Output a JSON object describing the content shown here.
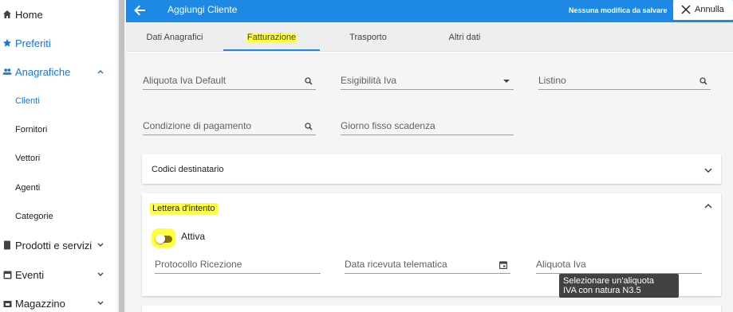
{
  "sidebar": {
    "items": [
      {
        "label": "Home",
        "icon": "home-icon"
      },
      {
        "label": "Preferiti",
        "icon": "star-icon"
      },
      {
        "label": "Anagrafiche",
        "icon": "people-icon",
        "expanded": true
      },
      {
        "label": "Clienti"
      },
      {
        "label": "Fornitori"
      },
      {
        "label": "Vettori"
      },
      {
        "label": "Agenti"
      },
      {
        "label": "Categorie"
      },
      {
        "label": "Prodotti e servizi",
        "icon": "book-icon"
      },
      {
        "label": "Eventi",
        "icon": "calendar-icon"
      },
      {
        "label": "Magazzino",
        "icon": "warehouse-icon"
      }
    ]
  },
  "header": {
    "title": "Aggiungi Cliente",
    "status": "Nessuna modifica da salvare",
    "cancel_label": "Annulla"
  },
  "tabs": [
    {
      "label": "Dati Anagrafici"
    },
    {
      "label": "Fatturazione",
      "active": true
    },
    {
      "label": "Trasporto"
    },
    {
      "label": "Altri dati"
    }
  ],
  "fields": {
    "aliquota_iva_default": "Aliquota Iva Default",
    "esigibilita_iva": "Esigibilità Iva",
    "listino": "Listino",
    "condizione_pagamento": "Condizione di pagamento",
    "giorno_fisso_scadenza": "Giorno fisso scadenza"
  },
  "panels": {
    "codici_destinatario": "Codici destinatario",
    "lettera_intento": {
      "title": "Lettera d'intento",
      "toggle_label": "Attiva",
      "protocollo_ricezione": "Protocollo Ricezione",
      "data_ricevuta": "Data ricevuta telematica",
      "aliquota_iva": "Aliquota Iva"
    }
  },
  "tooltip": {
    "line1": "Selezionare un'aliquota",
    "line2": "IVA con natura N3.5"
  },
  "colors": {
    "primary": "#1e88e5",
    "highlight": "#ffff3c",
    "sidebar_active": "#1976d2"
  }
}
